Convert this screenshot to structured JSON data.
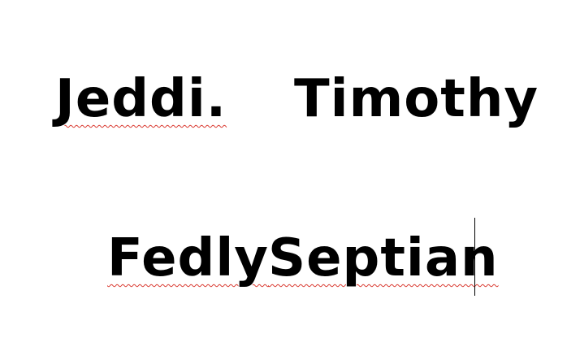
{
  "document": {
    "line1": {
      "word1": "Jeddi.",
      "word2": "Timothy"
    },
    "line2": {
      "word1": "Fedly",
      "word2": "Septian"
    }
  },
  "colors": {
    "text": "#000000",
    "spellcheck_underline": "#d9382f",
    "page": "#ffffff"
  }
}
